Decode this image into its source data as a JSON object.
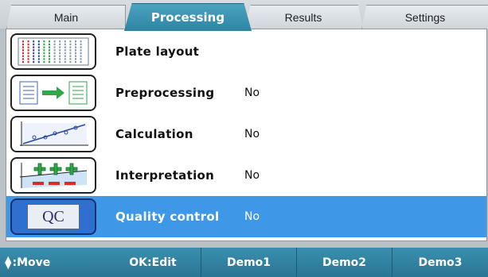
{
  "tabs": {
    "main": "Main",
    "processing": "Processing",
    "results": "Results",
    "settings": "Settings"
  },
  "rows": [
    {
      "label": "Plate layout",
      "value": "",
      "icon": "plate-layout-icon"
    },
    {
      "label": "Preprocessing",
      "value": "No",
      "icon": "preprocessing-icon"
    },
    {
      "label": "Calculation",
      "value": "No",
      "icon": "calculation-icon"
    },
    {
      "label": "Interpretation",
      "value": "No",
      "icon": "interpretation-icon"
    },
    {
      "label": "Quality control",
      "value": "No",
      "icon": "qc-icon",
      "icon_text": "QC"
    }
  ],
  "bottom": {
    "move": ":Move",
    "edit": "OK:Edit",
    "demo1": "Demo1",
    "demo2": "Demo2",
    "demo3": "Demo3"
  },
  "colors": {
    "active_tab": "#2f84a4",
    "selected_row": "#3f97e8",
    "bottom_bar": "#2a7594"
  }
}
